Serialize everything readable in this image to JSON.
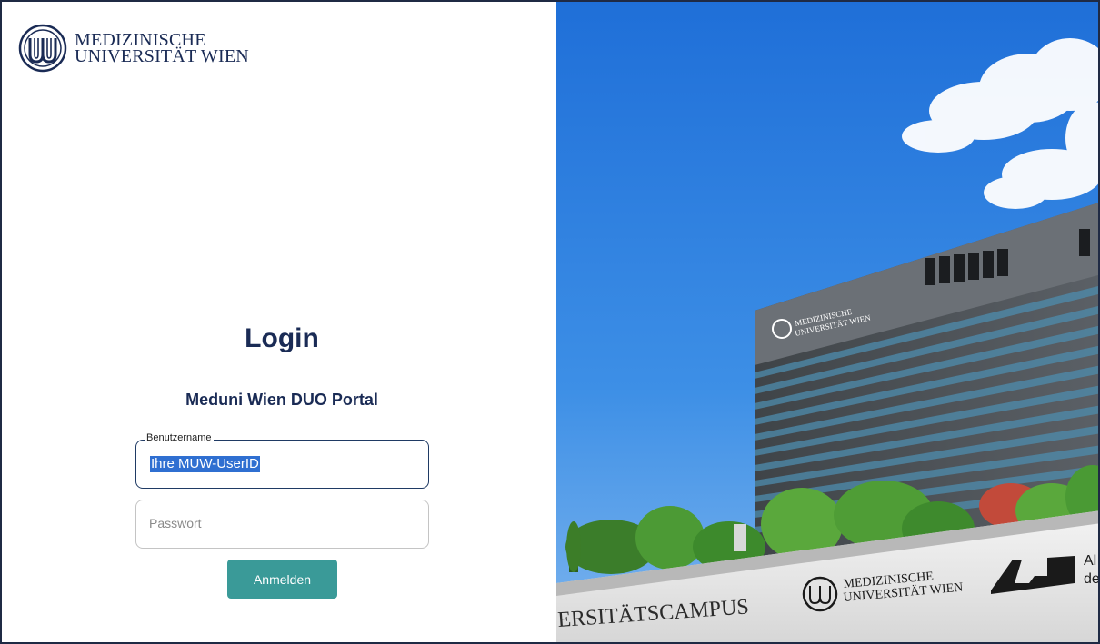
{
  "logo": {
    "line1": "MEDIZINISCHE",
    "line2": "UNIVERSITÄT WIEN"
  },
  "login": {
    "title": "Login",
    "subtitle": "Meduni Wien DUO Portal",
    "username_label": "Benutzername",
    "username_value": "Ihre MUW-UserID",
    "password_placeholder": "Passwort",
    "submit_label": "Anmelden"
  },
  "photo": {
    "building_sign_line1": "MEDIZINISCHE",
    "building_sign_line2": "UNIVERSITÄT WIEN",
    "banner_text": "ERSITÄTSCAMPUS",
    "banner_logo_line1": "MEDIZINISCHE",
    "banner_logo_line2": "UNIVERSITÄT WIEN",
    "akh_text_1": "Al",
    "akh_text_2": "de"
  },
  "colors": {
    "brand_navy": "#1a2b55",
    "button_teal": "#3a9a98",
    "selection_blue": "#2f6fd1",
    "sky_blue": "#2a7ee0"
  }
}
